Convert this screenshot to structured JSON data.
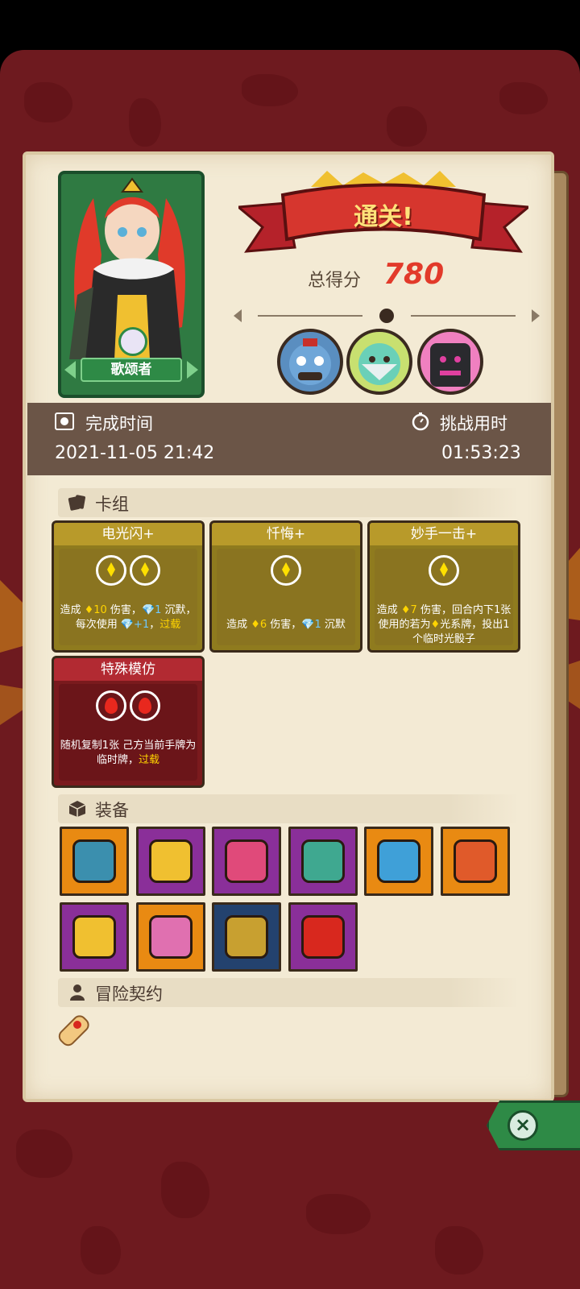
{
  "result": {
    "title": "通关!",
    "score_label": "总得分",
    "score_value": "780"
  },
  "hero": {
    "name": "歌颂者"
  },
  "bosses": [
    "boss-portrait-1",
    "boss-portrait-2",
    "boss-portrait-3"
  ],
  "times": {
    "complete_label": "完成时间",
    "complete_value": "2021-11-05 21:42",
    "duration_label": "挑战用时",
    "duration_value": "01:53:23"
  },
  "sections": {
    "deck": "卡组",
    "equipment": "装备",
    "contract": "冒险契约"
  },
  "cards": [
    {
      "title": "电光闪+",
      "color": "yellow",
      "gems": [
        "light",
        "light"
      ],
      "desc": {
        "a": "造成 ",
        "v1": "♦10",
        "b": " 伤害，",
        "v2": "💎1",
        "c": " 沉默，每次使用 ",
        "v3": "💎+1",
        "d": "，",
        "v4": "过载"
      }
    },
    {
      "title": "忏悔+",
      "color": "yellow",
      "gems": [
        "light"
      ],
      "desc": {
        "a": "造成 ",
        "v1": "♦6",
        "b": " 伤害，",
        "v2": "💎1",
        "c": " 沉默"
      }
    },
    {
      "title": "妙手一击+",
      "color": "yellow",
      "gems": [
        "light"
      ],
      "desc": {
        "a": "造成 ",
        "v1": "♦7",
        "b": " 伤害，回合内下1张使用的若为",
        "v2": "♦",
        "c": "光系牌，投出1个临时光骰子"
      }
    },
    {
      "title": "特殊模仿",
      "color": "red",
      "gems": [
        "fire",
        "fire"
      ],
      "desc": {
        "a": "随机复制1张 己方当前手牌为临时牌，",
        "v1": "过载"
      }
    }
  ],
  "equipment": [
    {
      "name": "vase-item",
      "bg": "#e98a12",
      "art": "#3b8fae"
    },
    {
      "name": "cheese-cube-item",
      "bg": "#8a2f99",
      "art": "#f0c030"
    },
    {
      "name": "pink-cloth-item",
      "bg": "#8a2f99",
      "art": "#e04a7a"
    },
    {
      "name": "clock-golem-item",
      "bg": "#8a2f99",
      "art": "#3fa890"
    },
    {
      "name": "ice-shield-item",
      "bg": "#e98a12",
      "art": "#3fa0d8"
    },
    {
      "name": "donut-item",
      "bg": "#e98a12",
      "art": "#e05a2a"
    },
    {
      "name": "gold-triangle-item",
      "bg": "#8a2f99",
      "art": "#f0c030"
    },
    {
      "name": "pink-flower-item",
      "bg": "#e98a12",
      "art": "#e070b0"
    },
    {
      "name": "jeweled-ring-item",
      "bg": "#23426e",
      "art": "#c8a030"
    },
    {
      "name": "red-sack-item",
      "bg": "#8a2f99",
      "art": "#d8281e"
    }
  ]
}
